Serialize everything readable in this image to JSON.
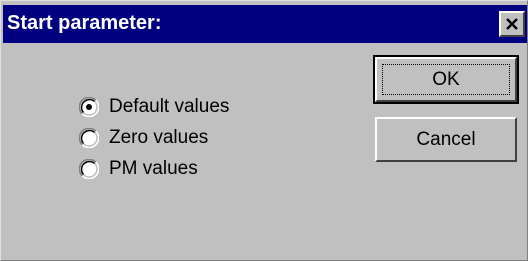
{
  "window": {
    "title": "Start parameter:",
    "titlebar_color": "#000080",
    "face_color": "#c0c0c0"
  },
  "titlebar": {
    "close_icon": "close-icon"
  },
  "options": {
    "items": [
      {
        "label": "Default values",
        "selected": true
      },
      {
        "label": "Zero values",
        "selected": false
      },
      {
        "label": "PM values",
        "selected": false
      }
    ]
  },
  "buttons": {
    "ok_label": "OK",
    "cancel_label": "Cancel"
  }
}
